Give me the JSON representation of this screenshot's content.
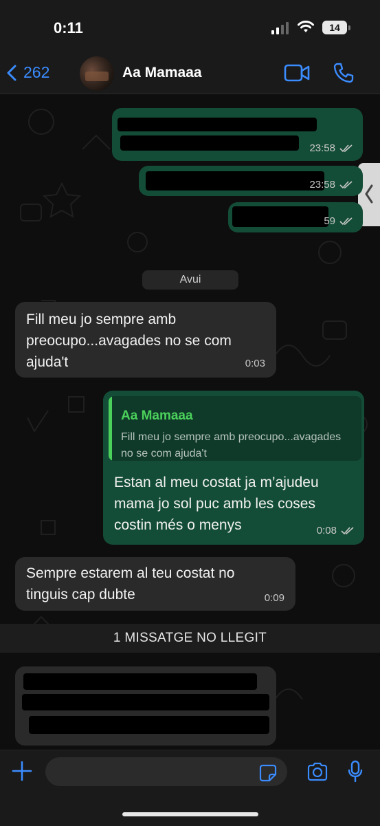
{
  "status_bar": {
    "time": "0:11",
    "battery": "14"
  },
  "header": {
    "back_count": "262",
    "contact_name": "Aa Mamaaa"
  },
  "chat": {
    "redacted_messages": [
      {
        "time": "23:58"
      },
      {
        "time": "23:58"
      },
      {
        "time": "59"
      }
    ],
    "date_separator": "Avui",
    "messages": [
      {
        "id": "m1",
        "direction": "incoming",
        "text": "Fill meu jo sempre amb preocupo...avagades no se com ajuda't",
        "time": "0:03"
      },
      {
        "id": "m2",
        "direction": "outgoing",
        "quote": {
          "author": "Aa Mamaaa",
          "text": "Fill meu jo sempre amb preocupo...avagades no se com ajuda't"
        },
        "text": "Estan al meu costat ja m’ajudeu mama jo sol puc amb les coses costin més o menys",
        "time": "0:08"
      },
      {
        "id": "m3",
        "direction": "incoming",
        "text": "Sempre estarem al teu costat no tinguis cap dubte",
        "time": "0:09"
      }
    ],
    "unread_banner": "1 MISSATGE NO LLEGIT"
  },
  "composer": {
    "placeholder": ""
  },
  "colors": {
    "accent": "#3b8cff",
    "outgoing_bubble": "#144d37",
    "incoming_bubble": "#2a2a2a",
    "quote_accent": "#4bd15b"
  }
}
